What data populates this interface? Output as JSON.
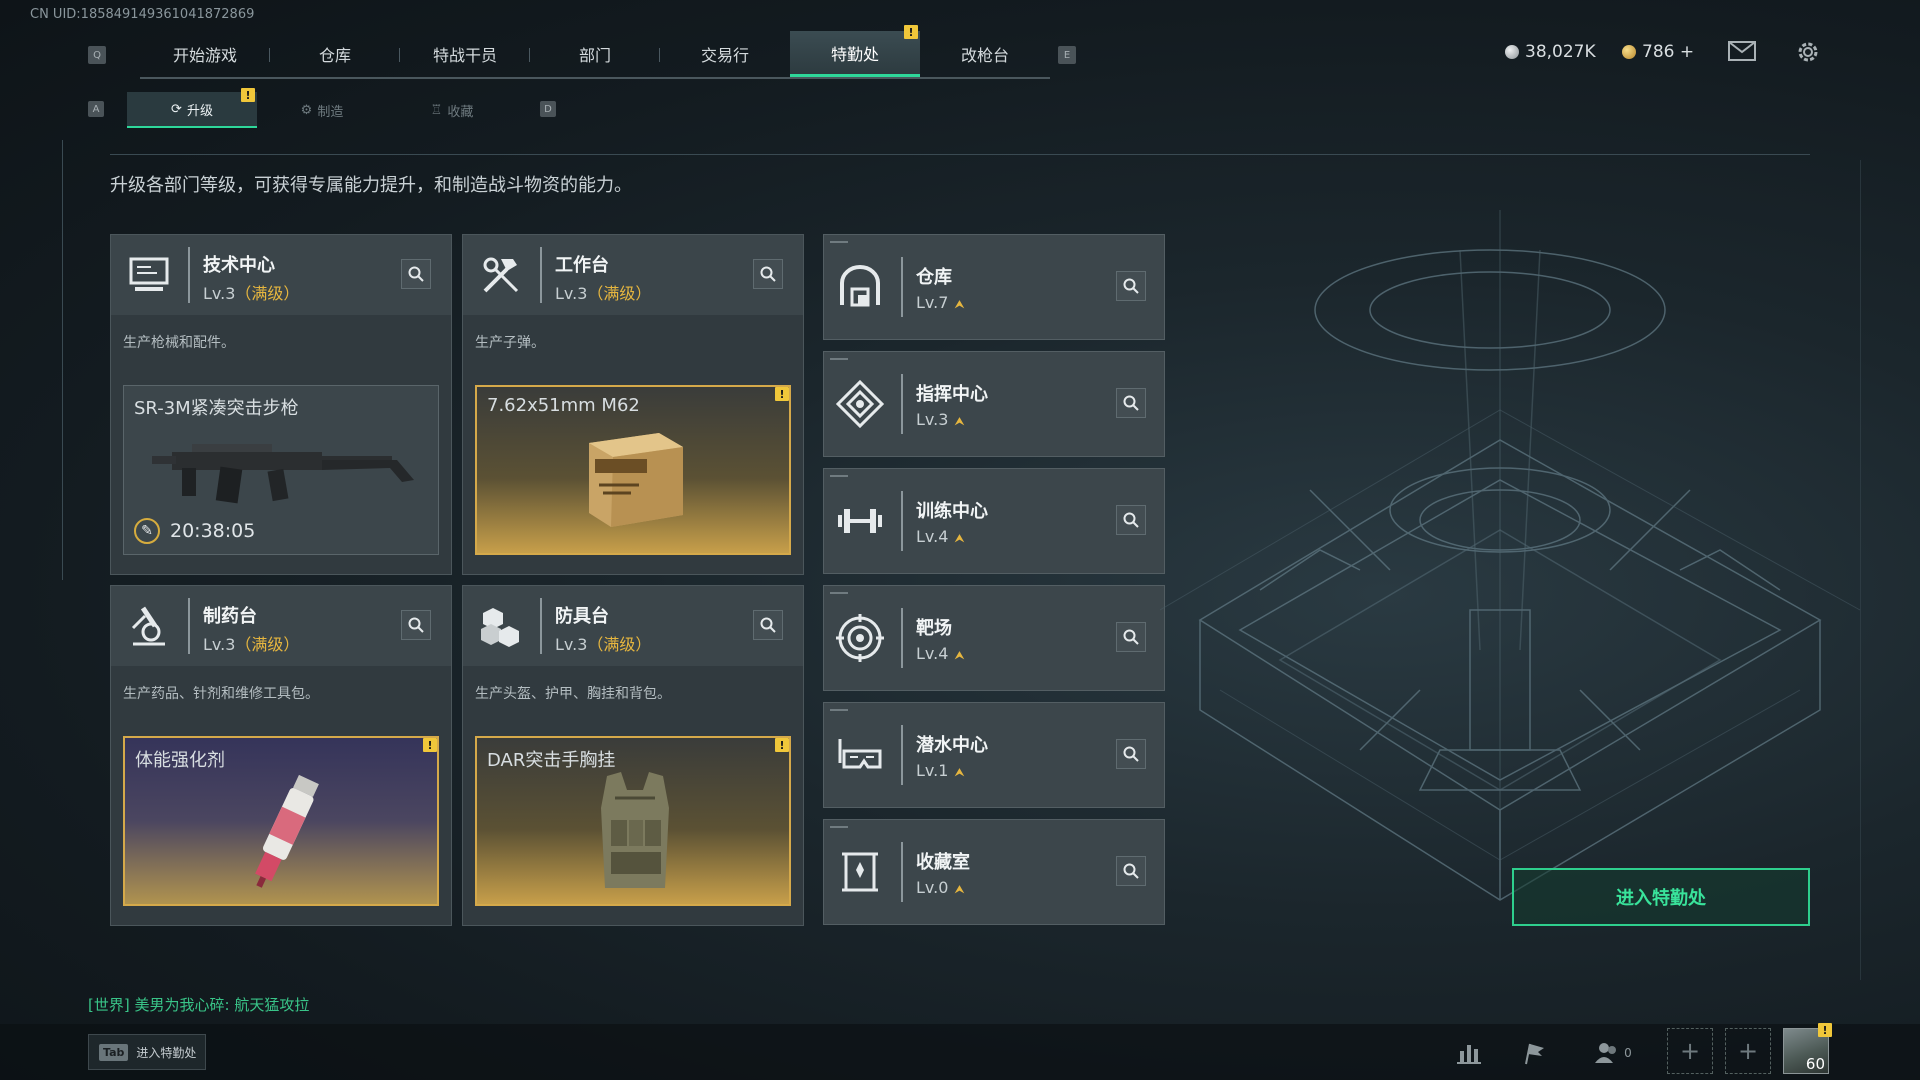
{
  "uid": "CN UID:18584914936104187​2869",
  "top_nav": {
    "left_key": "Q",
    "right_key": "E",
    "tabs": [
      {
        "label": "开始游戏"
      },
      {
        "label": "仓库"
      },
      {
        "label": "特战干员"
      },
      {
        "label": "部门"
      },
      {
        "label": "交易行"
      },
      {
        "label": "特勤处",
        "active": true,
        "alert": "!"
      },
      {
        "label": "改枪台"
      }
    ]
  },
  "currency": {
    "silver": "38,027K",
    "gold": "786 +"
  },
  "sub_nav": {
    "left_key": "A",
    "right_key": "D",
    "tabs": [
      {
        "label": "升级",
        "active": true,
        "alert": "!"
      },
      {
        "label": "制造"
      },
      {
        "label": "收藏"
      }
    ]
  },
  "description": "升级各部门等级，可获得专属能力提升，和制造战斗物资的能力。",
  "departments": [
    {
      "title": "技术中心",
      "level": "Lv.3",
      "maxed": "（满级）",
      "icon": "computer-icon",
      "desc": "生产枪械和配件。",
      "product": {
        "name": "SR-3M紧凑突击步枪",
        "timer": "20:38:05",
        "style": "plain",
        "icon": "rifle-icon"
      }
    },
    {
      "title": "工作台",
      "level": "Lv.3",
      "maxed": "（满级）",
      "icon": "tools-icon",
      "desc": "生产子弹。",
      "product": {
        "name": "7.62x51mm M62",
        "style": "gold",
        "alert": "!",
        "icon": "ammo-box-icon"
      }
    },
    {
      "title": "制药台",
      "level": "Lv.3",
      "maxed": "（满级）",
      "icon": "microscope-icon",
      "desc": "生产药品、针剂和维修工具包。",
      "product": {
        "name": "体能强化剂",
        "style": "purple",
        "alert": "!",
        "icon": "injector-icon"
      }
    },
    {
      "title": "防具台",
      "level": "Lv.3",
      "maxed": "（满级）",
      "icon": "cubes-icon",
      "desc": "生产头盔、护甲、胸挂和背包。",
      "product": {
        "name": "DAR突击手胸挂",
        "style": "gold",
        "alert": "!",
        "icon": "vest-icon"
      }
    }
  ],
  "facilities": [
    {
      "title": "仓库",
      "level": "Lv.7",
      "icon": "warehouse-icon"
    },
    {
      "title": "指挥中心",
      "level": "Lv.3",
      "icon": "command-icon"
    },
    {
      "title": "训练中心",
      "level": "Lv.4",
      "icon": "dumbbell-icon"
    },
    {
      "title": "靶场",
      "level": "Lv.4",
      "icon": "target-icon"
    },
    {
      "title": "潜水中心",
      "level": "Lv.1",
      "icon": "diving-mask-icon"
    },
    {
      "title": "收藏室",
      "level": "Lv.0",
      "icon": "trophy-case-icon"
    }
  ],
  "enter_button": "进入特勤处",
  "chat": {
    "channel": "[世界]",
    "text": "美男为我心碎: 航天猛攻拉"
  },
  "bottom": {
    "tab_key": "Tab",
    "tab_label": "进入特勤处",
    "friends_count": "0",
    "player_level": "60",
    "alert": "!"
  },
  "colors": {
    "accent_green": "#2ed79a",
    "maxed_gold": "#e6b63f",
    "alert_yellow": "#f0c73a"
  }
}
